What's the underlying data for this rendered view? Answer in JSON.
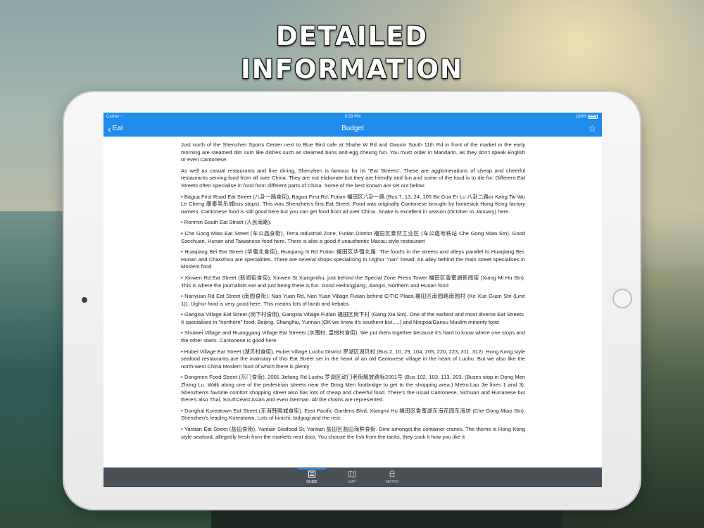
{
  "headline": {
    "line1": "DETAILED",
    "line2": "INFORMATION"
  },
  "status_bar": {
    "carrier": "Carrier",
    "time": "6:29 PM",
    "battery": "100%"
  },
  "nav": {
    "back_label": "Eat",
    "title": "Budget",
    "back_icon": "chevron-left-icon",
    "favorite_icon": "star-icon"
  },
  "article": {
    "paragraphs": [
      "Just north of the Shenzhen Sports Center next to Blue Bird cafe at Shahe W Rd and Gaoxin South 11th Rd in front of the market in the early morning are steamed dim sum like dishes such as steamed buns and egg cheung fun. You must order in Mandarin, as they don't speak English or even Cantonese.",
      "As well as casual restaurants and fine dining, Shenzhen is famous for its \"Eat Streets\". These are agglomerations of cheap and cheerful restaurants serving food from all over China. They are not elaborate but they are friendly and fun and some of the food is to die for. Different Eat Streets often specialise in food from different parts of China. Some of the best known are set out below:",
      "• Bagua First Road Eat Street (八卦一路食街), Bagua First Rd, Futian 福田区八卦一路 (Bus 7, 13, 24, 105 Ba Gua Er Lu 八卦二路or Kang Tai Wu Le Cheng 康泰吴乐城bus stops). This was Shenzhen's first Eat Street. Food was originally Cantonese brought by homesick Hong Kong factory owners. Cantonese food is still good here but you can get food from all over China. Snake is excellent in season (October to January) here.",
      "• Renmin South Eat Street (人民南路).",
      "• Che Gong Miao Eat Street (车公庙食街), Terra Industrial Zone, Futian District 福田区泰然工业区 (车公庙地铁站 Che Gong Miao Stn). Good Szechuan, Hunan and Taiwanese food here. There is also a good if unauthentic Macau style restaurant",
      "• Huaqiang Bei Eat Street (华强北食街), Huaqiang N Rd Futian 福田区华强北路. The food's in the streets and alleys parallel to Huaqiang Bei. Hunan and Chaozhou are specialities. There are several shops specialising in Uighur \"nan\" bread. An alley behind the main street specialises in Moslem food",
      "• Xinwen Rd Eat Street (新闻街食街), Xinwen St Xiangmihu, just behind the Special Zone Press Tower 福田区香蜜湖新闻街 (Xiang Mi Hu Stn). This is where the journalists eat and just being there is fun. Good Heilongjiang, Jiangxi, Northern and Hunan food",
      "• Nanyuan Rd Eat Street (南园食街), Nan Yuan Rd, Nan Yuan Village Futian behind CITIC Plaza,福田区南园路南园村 (Ke Xue Guan Stn (Line 1)). Uighur food is very good here. This means lots of lamb and kebabs",
      "• Gangxia Village Eat Street (岗下村食街), Gangxia Village Futian 福田区岗下村 (Gang Xia Stn). One of the earliest and most diverse Eat Streets. It specialises in \"northern\" food, Beijing, Shanghai, Yunnan (OK we know it's southern but.....) and Ningxia/Gansu Muslim minority food",
      "• Shuiwei Village and Huanggang Village Eat Streets (水围村, 皇岗村食街). We put them together because it's hard to know where one stops and the other starts. Cantonese is good here",
      "• Hubei Village Eat Street (湖贝村食街), Hubei Village Luohu District 罗湖区湖贝村 (Bus 2, 10, 29, 104, 205, 220, 223, 311, 312). Hong Kong style seafood restaurants are the mainstay of this Eat Street set in the heart of an old Cantonese village in the heart of Luohu. But we also like the north-west China Moslem food of which there is plenty",
      "• Dongmen Food Street (东门食街), 2001 Jiefang Rd Luohu 罗湖区动门老街解放路标2001号 (Bus 102, 103, 113, 203. (Buses stop in Dong Men Zhong Lu. Walk along one of the pedestrian streets near the Dong Men footbridge to get to the shopping area.) Metro:Lao Jie lines 1 and 3). Shenzhen's favorite comfort shopping street also has lots of cheap and cheerful food. There's the usual Cantonese, Sichuan and Hunanese but there's also Thai, South=east Asian and even German. All the chains are represented.",
      "• Donghai Koreatown Eat Street (东海韩国城食街), East Pacific Gardens Blvd, Xiangmi Hu 福田区香蜜湖东海花园东海坊 (Che Gong Miao Stn). Shenzhen's leading Koreatown. Lots of kimchi, bulgogi and the rest.",
      "• Yantian Eat Street (盐田食街), Yantian Seafood St, Yantian 盐田区盐田海鲜食街. Dine amongst the container cranes. The theme is Hong Kong style seafood, allegedly fresh from the markets next door. You choose the fish from the tanks, they cook it how you like it"
    ]
  },
  "tabs": [
    {
      "label": "GUIDE",
      "icon": "guide-icon",
      "active": true
    },
    {
      "label": "MAP",
      "icon": "map-icon",
      "active": false
    },
    {
      "label": "METRO",
      "icon": "metro-icon",
      "active": false
    }
  ],
  "colors": {
    "nav_blue": "#1f8cec",
    "tab_bar": "#4b5057"
  }
}
